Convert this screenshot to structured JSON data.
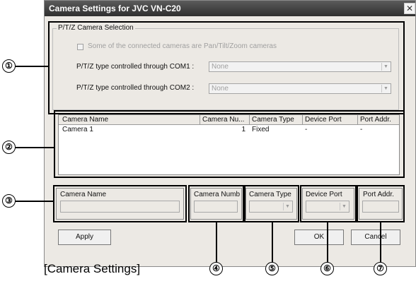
{
  "window": {
    "title": "Camera Settings for JVC VN-C20",
    "close_glyph": "✕"
  },
  "ptz": {
    "group_label": "P/T/Z Camera Selection",
    "checkbox_label": "Some of the connected cameras are Pan/Tilt/Zoom cameras",
    "com1_label": "P/T/Z type controlled through COM1 :",
    "com1_value": "None",
    "com2_label": "P/T/Z type controlled through COM2 :",
    "com2_value": "None"
  },
  "camera_list": {
    "columns": [
      "Camera Name",
      "Camera Nu...",
      "Camera Type",
      "Device Port",
      "Port Addr."
    ],
    "rows": [
      {
        "name": "Camera 1",
        "number": "1",
        "type": "Fixed",
        "port": "-",
        "addr": "-"
      }
    ]
  },
  "fields": {
    "camera_name_label": "Camera Name",
    "camera_number_label": "Camera Numb",
    "camera_type_label": "Camera Type",
    "device_port_label": "Device Port",
    "port_addr_label": "Port Addr."
  },
  "buttons": {
    "apply": "Apply",
    "ok": "OK",
    "cancel": "Cancel"
  },
  "callouts": [
    "①",
    "②",
    "③",
    "④",
    "⑤",
    "⑥",
    "⑦"
  ],
  "caption": "[Camera Settings]",
  "icons": {
    "dropdown_arrow": "▼"
  }
}
